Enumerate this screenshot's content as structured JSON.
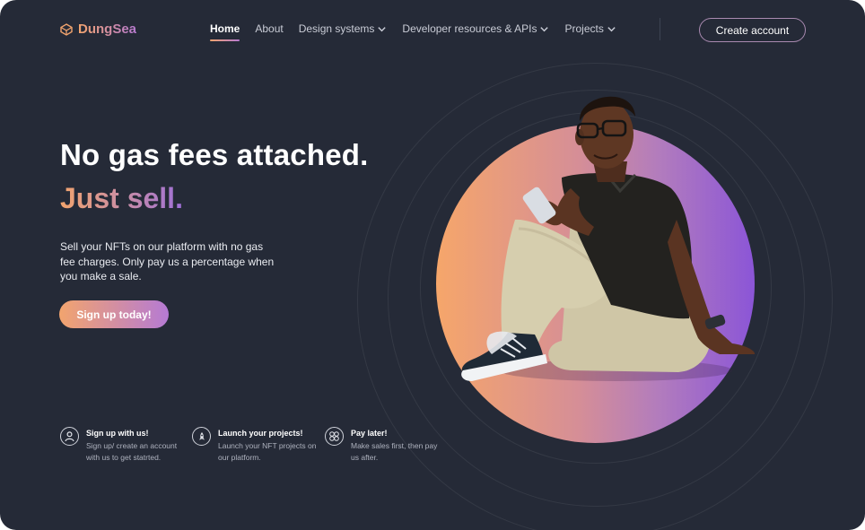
{
  "brand": {
    "name": "DungSea"
  },
  "nav": {
    "items": [
      {
        "label": "Home",
        "active": true,
        "dropdown": false
      },
      {
        "label": "About",
        "active": false,
        "dropdown": false
      },
      {
        "label": "Design systems",
        "active": false,
        "dropdown": true
      },
      {
        "label": "Developer resources & APIs",
        "active": false,
        "dropdown": true
      },
      {
        "label": "Projects",
        "active": false,
        "dropdown": true
      }
    ],
    "create_account_label": "Create account"
  },
  "hero": {
    "headline": "No gas fees attached.",
    "headline_accent": "Just sell.",
    "description": "Sell your NFTs on our platform with no gas fee charges. Only pay us a percentage when you make a sale.",
    "cta_label": "Sign up today!"
  },
  "features": [
    {
      "icon": "user-icon",
      "title": "Sign up with us!",
      "text": "Sign up/ create an account with us to get statrted."
    },
    {
      "icon": "rocket-icon",
      "title": "Launch your projects!",
      "text": "Launch your NFT projects on our platform."
    },
    {
      "icon": "coins-icon",
      "title": "Pay later!",
      "text": "Make sales first, then pay us after."
    }
  ],
  "colors": {
    "background": "#252a37",
    "accent_start": "#f2a46e",
    "accent_end": "#9e6fd8"
  }
}
